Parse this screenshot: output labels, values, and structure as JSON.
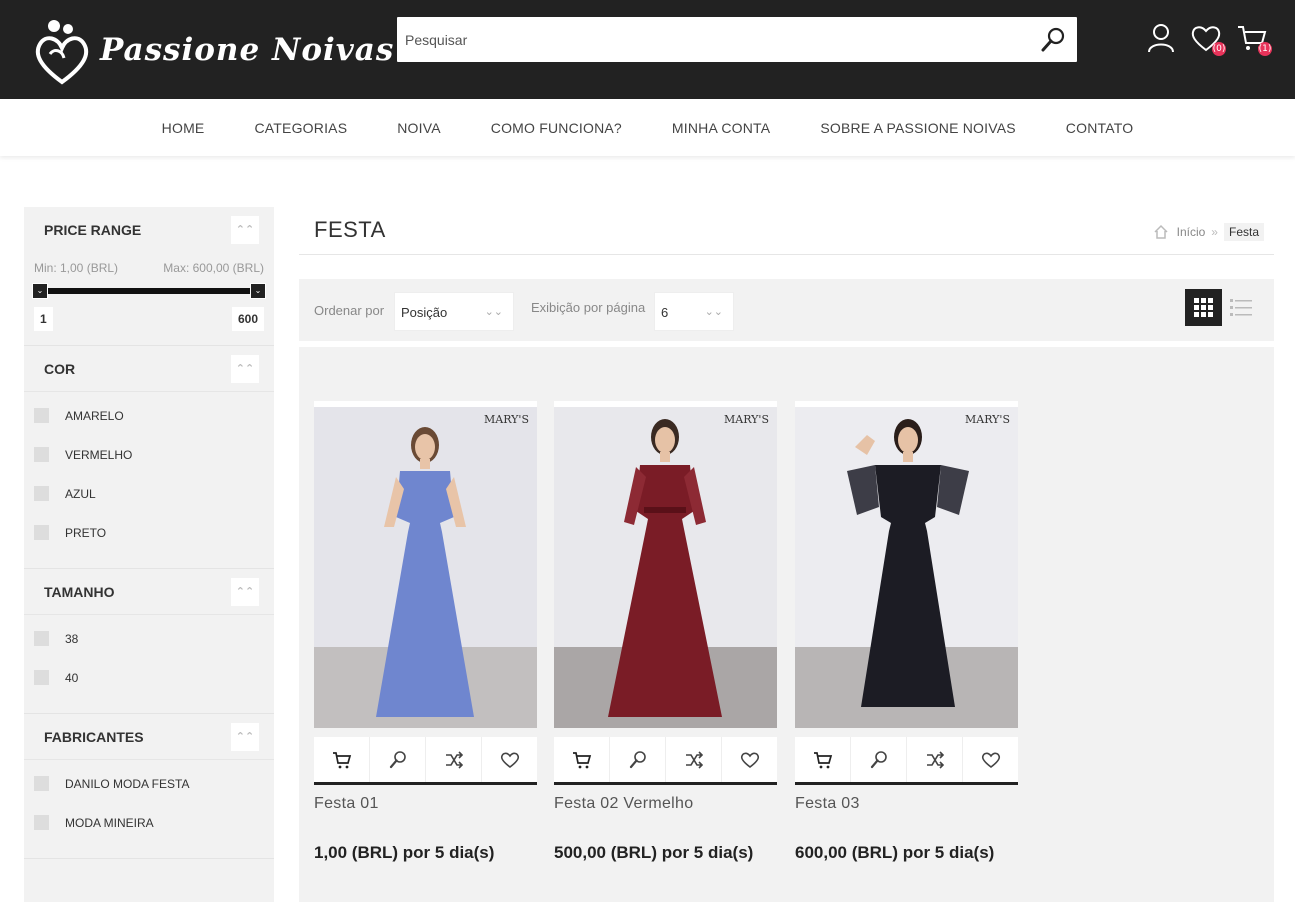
{
  "header": {
    "brand": "Passione Noivas",
    "search_placeholder": "Pesquisar",
    "wishlist_count": "(0)",
    "cart_count": "(1)"
  },
  "nav": {
    "items": [
      "HOME",
      "CATEGORIAS",
      "NOIVA",
      "COMO FUNCIONA?",
      "MINHA CONTA",
      "SOBRE A PASSIONE NOIVAS",
      "CONTATO"
    ]
  },
  "sidebar": {
    "price": {
      "title": "PRICE RANGE",
      "min_label": "Min: 1,00 (BRL)",
      "max_label": "Max: 600,00 (BRL)",
      "from": "1",
      "to": "600"
    },
    "color": {
      "title": "COR",
      "options": [
        "AMARELO",
        "VERMELHO",
        "AZUL",
        "PRETO"
      ]
    },
    "size": {
      "title": "TAMANHO",
      "options": [
        "38",
        "40"
      ]
    },
    "brands": {
      "title": "FABRICANTES",
      "options": [
        "DANILO MODA FESTA",
        "MODA MINEIRA"
      ]
    }
  },
  "main": {
    "title": "FESTA",
    "breadcrumb": {
      "home": "Início",
      "current": "Festa"
    },
    "toolbar": {
      "sort_label": "Ordenar por",
      "sort_value": "Posição",
      "per_page_label": "Exibição por página",
      "per_page_value": "6"
    },
    "products": [
      {
        "name": "Festa 01",
        "price": "1,00 (BRL) por 5 dia(s)",
        "brand_mark": "MARY'S",
        "dress_color": "#6f86cf"
      },
      {
        "name": "Festa 02 Vermelho",
        "price": "500,00 (BRL) por 5 dia(s)",
        "brand_mark": "MARY'S",
        "dress_color": "#7a1c26"
      },
      {
        "name": "Festa 03",
        "price": "600,00 (BRL) por 5 dia(s)",
        "brand_mark": "MARY'S",
        "dress_color": "#1c1c24"
      }
    ]
  },
  "icons": [
    "logo-icon",
    "search-icon",
    "user-icon",
    "heart-icon",
    "cart-icon",
    "home-icon",
    "grid-view-icon",
    "list-view-icon",
    "add-to-cart-icon",
    "quick-view-icon",
    "compare-icon",
    "wishlist-icon",
    "chevron-up-icon",
    "chevron-down-icon"
  ]
}
